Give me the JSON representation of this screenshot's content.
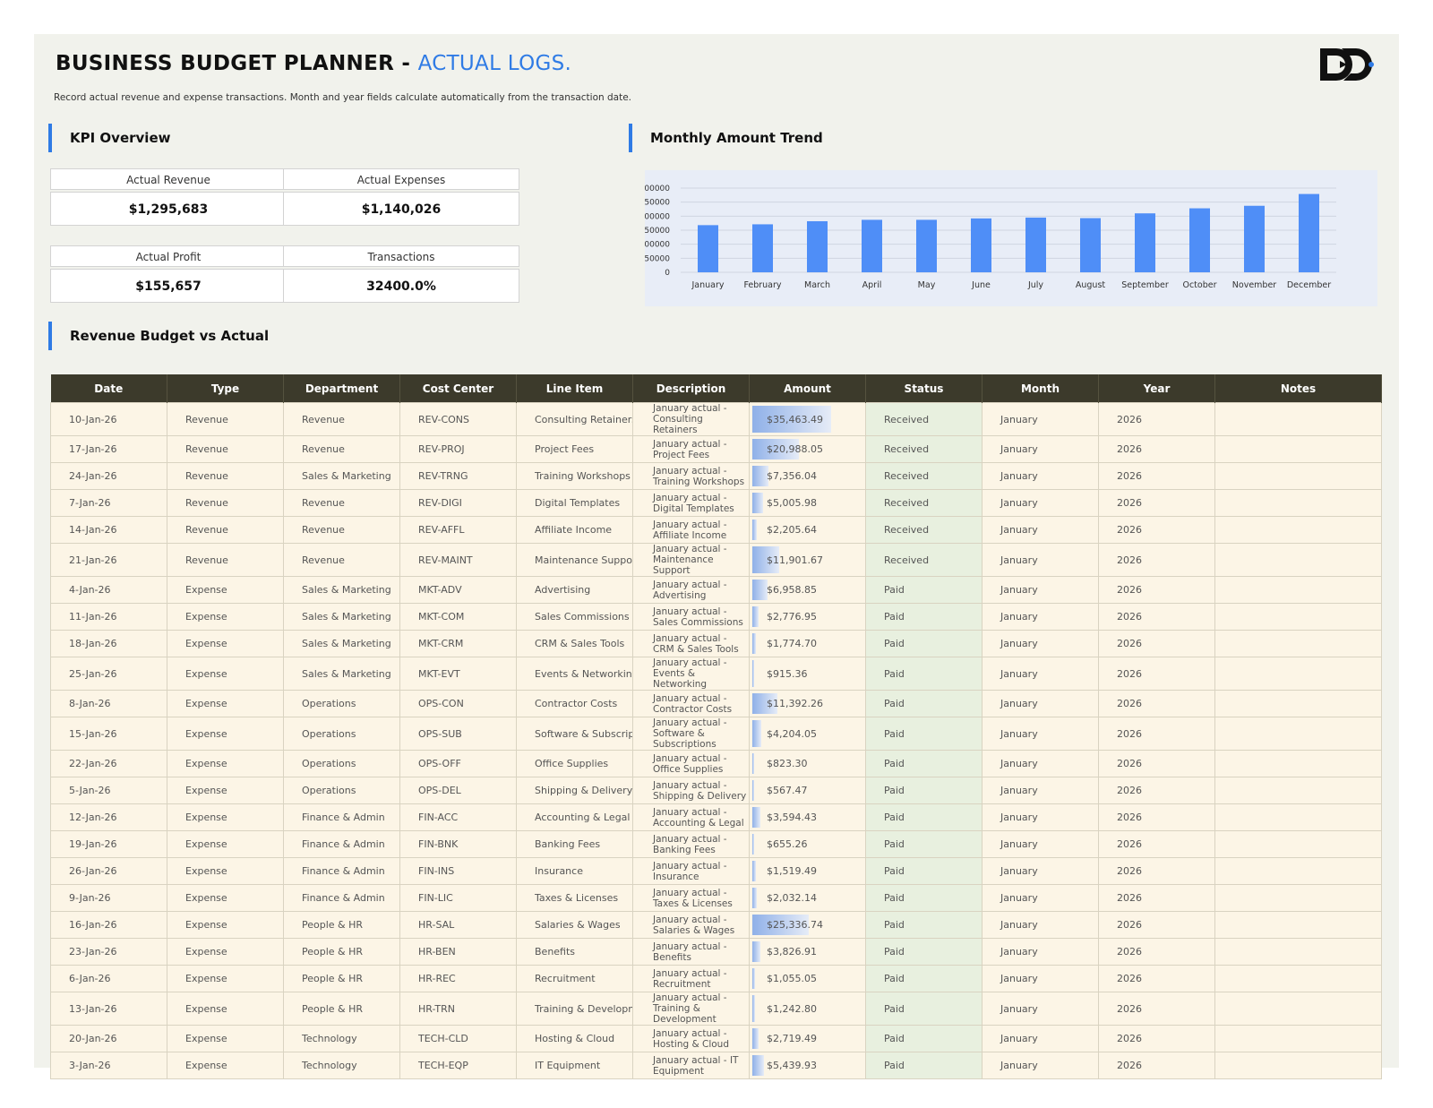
{
  "header": {
    "title_main": "BUSINESS BUDGET PLANNER - ",
    "title_accent": "ACTUAL LOGS.",
    "subtitle": "Record actual revenue and expense transactions. Month and year fields calculate automatically from the transaction date."
  },
  "colors": {
    "accent": "#2f7be5",
    "header_bg": "#3c3a2b",
    "row_bg": "#fcf5e6",
    "status_bg": "#e8f0df",
    "bar": "#4f8ef7"
  },
  "sections": {
    "kpi": "KPI Overview",
    "trend": "Monthly Amount Trend",
    "table": "Revenue Budget vs Actual"
  },
  "kpis": [
    {
      "label": "Actual Revenue",
      "value": "$1,295,683"
    },
    {
      "label": "Actual Expenses",
      "value": "$1,140,026"
    },
    {
      "label": "Actual Profit",
      "value": "$155,657"
    },
    {
      "label": "Transactions",
      "value": "32400.0%"
    }
  ],
  "chart_data": {
    "type": "bar",
    "title": "",
    "xlabel": "",
    "ylabel": "",
    "categories": [
      "January",
      "February",
      "March",
      "April",
      "May",
      "June",
      "July",
      "August",
      "September",
      "October",
      "November",
      "December"
    ],
    "values": [
      168000,
      171000,
      182000,
      187000,
      187000,
      192000,
      195000,
      193000,
      210000,
      228000,
      237000,
      279000
    ],
    "ylim": [
      0,
      300000
    ],
    "yticks": [
      0,
      50000,
      100000,
      150000,
      200000,
      250000,
      300000
    ],
    "grid": true
  },
  "table": {
    "columns": [
      "Date",
      "Type",
      "Department",
      "Cost Center",
      "Line Item",
      "Description",
      "Amount",
      "Status",
      "Month",
      "Year",
      "Notes"
    ],
    "rows": [
      {
        "date": "10-Jan-26",
        "type": "Revenue",
        "dept": "Revenue",
        "cc": "REV-CONS",
        "item": "Consulting Retainers",
        "desc": "January actual - Consulting Retainers",
        "amount": "$35,463.49",
        "amount_value": 35463.49,
        "status": "Received",
        "month": "January",
        "year": "2026",
        "notes": ""
      },
      {
        "date": "17-Jan-26",
        "type": "Revenue",
        "dept": "Revenue",
        "cc": "REV-PROJ",
        "item": "Project Fees",
        "desc": "January actual - Project Fees",
        "amount": "$20,988.05",
        "amount_value": 20988.05,
        "status": "Received",
        "month": "January",
        "year": "2026",
        "notes": ""
      },
      {
        "date": "24-Jan-26",
        "type": "Revenue",
        "dept": "Sales & Marketing",
        "cc": "REV-TRNG",
        "item": "Training Workshops",
        "desc": "January actual - Training Workshops",
        "amount": "$7,356.04",
        "amount_value": 7356.04,
        "status": "Received",
        "month": "January",
        "year": "2026",
        "notes": ""
      },
      {
        "date": "7-Jan-26",
        "type": "Revenue",
        "dept": "Revenue",
        "cc": "REV-DIGI",
        "item": "Digital Templates",
        "desc": "January actual - Digital Templates",
        "amount": "$5,005.98",
        "amount_value": 5005.98,
        "status": "Received",
        "month": "January",
        "year": "2026",
        "notes": ""
      },
      {
        "date": "14-Jan-26",
        "type": "Revenue",
        "dept": "Revenue",
        "cc": "REV-AFFL",
        "item": "Affiliate Income",
        "desc": "January actual - Affiliate Income",
        "amount": "$2,205.64",
        "amount_value": 2205.64,
        "status": "Received",
        "month": "January",
        "year": "2026",
        "notes": ""
      },
      {
        "date": "21-Jan-26",
        "type": "Revenue",
        "dept": "Revenue",
        "cc": "REV-MAINT",
        "item": "Maintenance Support",
        "desc": "January actual - Maintenance Support",
        "amount": "$11,901.67",
        "amount_value": 11901.67,
        "status": "Received",
        "month": "January",
        "year": "2026",
        "notes": ""
      },
      {
        "date": "4-Jan-26",
        "type": "Expense",
        "dept": "Sales & Marketing",
        "cc": "MKT-ADV",
        "item": "Advertising",
        "desc": "January actual - Advertising",
        "amount": "$6,958.85",
        "amount_value": 6958.85,
        "status": "Paid",
        "month": "January",
        "year": "2026",
        "notes": ""
      },
      {
        "date": "11-Jan-26",
        "type": "Expense",
        "dept": "Sales & Marketing",
        "cc": "MKT-COM",
        "item": "Sales Commissions",
        "desc": "January actual - Sales Commissions",
        "amount": "$2,776.95",
        "amount_value": 2776.95,
        "status": "Paid",
        "month": "January",
        "year": "2026",
        "notes": ""
      },
      {
        "date": "18-Jan-26",
        "type": "Expense",
        "dept": "Sales & Marketing",
        "cc": "MKT-CRM",
        "item": "CRM & Sales Tools",
        "desc": "January actual - CRM & Sales Tools",
        "amount": "$1,774.70",
        "amount_value": 1774.7,
        "status": "Paid",
        "month": "January",
        "year": "2026",
        "notes": ""
      },
      {
        "date": "25-Jan-26",
        "type": "Expense",
        "dept": "Sales & Marketing",
        "cc": "MKT-EVT",
        "item": "Events & Networking",
        "desc": "January actual - Events & Networking",
        "amount": "$915.36",
        "amount_value": 915.36,
        "status": "Paid",
        "month": "January",
        "year": "2026",
        "notes": ""
      },
      {
        "date": "8-Jan-26",
        "type": "Expense",
        "dept": "Operations",
        "cc": "OPS-CON",
        "item": "Contractor Costs",
        "desc": "January actual - Contractor Costs",
        "amount": "$11,392.26",
        "amount_value": 11392.26,
        "status": "Paid",
        "month": "January",
        "year": "2026",
        "notes": ""
      },
      {
        "date": "15-Jan-26",
        "type": "Expense",
        "dept": "Operations",
        "cc": "OPS-SUB",
        "item": "Software & Subscriptic",
        "desc": "January actual - Software & Subscriptions",
        "amount": "$4,204.05",
        "amount_value": 4204.05,
        "status": "Paid",
        "month": "January",
        "year": "2026",
        "notes": ""
      },
      {
        "date": "22-Jan-26",
        "type": "Expense",
        "dept": "Operations",
        "cc": "OPS-OFF",
        "item": "Office Supplies",
        "desc": "January actual - Office Supplies",
        "amount": "$823.30",
        "amount_value": 823.3,
        "status": "Paid",
        "month": "January",
        "year": "2026",
        "notes": ""
      },
      {
        "date": "5-Jan-26",
        "type": "Expense",
        "dept": "Operations",
        "cc": "OPS-DEL",
        "item": "Shipping & Delivery",
        "desc": "January actual - Shipping & Delivery",
        "amount": "$567.47",
        "amount_value": 567.47,
        "status": "Paid",
        "month": "January",
        "year": "2026",
        "notes": ""
      },
      {
        "date": "12-Jan-26",
        "type": "Expense",
        "dept": "Finance & Admin",
        "cc": "FIN-ACC",
        "item": "Accounting & Legal",
        "desc": "January actual - Accounting & Legal",
        "amount": "$3,594.43",
        "amount_value": 3594.43,
        "status": "Paid",
        "month": "January",
        "year": "2026",
        "notes": ""
      },
      {
        "date": "19-Jan-26",
        "type": "Expense",
        "dept": "Finance & Admin",
        "cc": "FIN-BNK",
        "item": "Banking Fees",
        "desc": "January actual - Banking Fees",
        "amount": "$655.26",
        "amount_value": 655.26,
        "status": "Paid",
        "month": "January",
        "year": "2026",
        "notes": ""
      },
      {
        "date": "26-Jan-26",
        "type": "Expense",
        "dept": "Finance & Admin",
        "cc": "FIN-INS",
        "item": "Insurance",
        "desc": "January actual - Insurance",
        "amount": "$1,519.49",
        "amount_value": 1519.49,
        "status": "Paid",
        "month": "January",
        "year": "2026",
        "notes": ""
      },
      {
        "date": "9-Jan-26",
        "type": "Expense",
        "dept": "Finance & Admin",
        "cc": "FIN-LIC",
        "item": "Taxes & Licenses",
        "desc": "January actual - Taxes & Licenses",
        "amount": "$2,032.14",
        "amount_value": 2032.14,
        "status": "Paid",
        "month": "January",
        "year": "2026",
        "notes": ""
      },
      {
        "date": "16-Jan-26",
        "type": "Expense",
        "dept": "People & HR",
        "cc": "HR-SAL",
        "item": "Salaries & Wages",
        "desc": "January actual - Salaries & Wages",
        "amount": "$25,336.74",
        "amount_value": 25336.74,
        "status": "Paid",
        "month": "January",
        "year": "2026",
        "notes": ""
      },
      {
        "date": "23-Jan-26",
        "type": "Expense",
        "dept": "People & HR",
        "cc": "HR-BEN",
        "item": "Benefits",
        "desc": "January actual - Benefits",
        "amount": "$3,826.91",
        "amount_value": 3826.91,
        "status": "Paid",
        "month": "January",
        "year": "2026",
        "notes": ""
      },
      {
        "date": "6-Jan-26",
        "type": "Expense",
        "dept": "People & HR",
        "cc": "HR-REC",
        "item": "Recruitment",
        "desc": "January actual - Recruitment",
        "amount": "$1,055.05",
        "amount_value": 1055.05,
        "status": "Paid",
        "month": "January",
        "year": "2026",
        "notes": ""
      },
      {
        "date": "13-Jan-26",
        "type": "Expense",
        "dept": "People & HR",
        "cc": "HR-TRN",
        "item": "Training & Developme",
        "desc": "January actual - Training & Development",
        "amount": "$1,242.80",
        "amount_value": 1242.8,
        "status": "Paid",
        "month": "January",
        "year": "2026",
        "notes": ""
      },
      {
        "date": "20-Jan-26",
        "type": "Expense",
        "dept": "Technology",
        "cc": "TECH-CLD",
        "item": "Hosting & Cloud",
        "desc": "January actual - Hosting & Cloud",
        "amount": "$2,719.49",
        "amount_value": 2719.49,
        "status": "Paid",
        "month": "January",
        "year": "2026",
        "notes": ""
      },
      {
        "date": "3-Jan-26",
        "type": "Expense",
        "dept": "Technology",
        "cc": "TECH-EQP",
        "item": "IT Equipment",
        "desc": "January actual - IT Equipment",
        "amount": "$5,439.93",
        "amount_value": 5439.93,
        "status": "Paid",
        "month": "January",
        "year": "2026",
        "notes": ""
      }
    ]
  }
}
